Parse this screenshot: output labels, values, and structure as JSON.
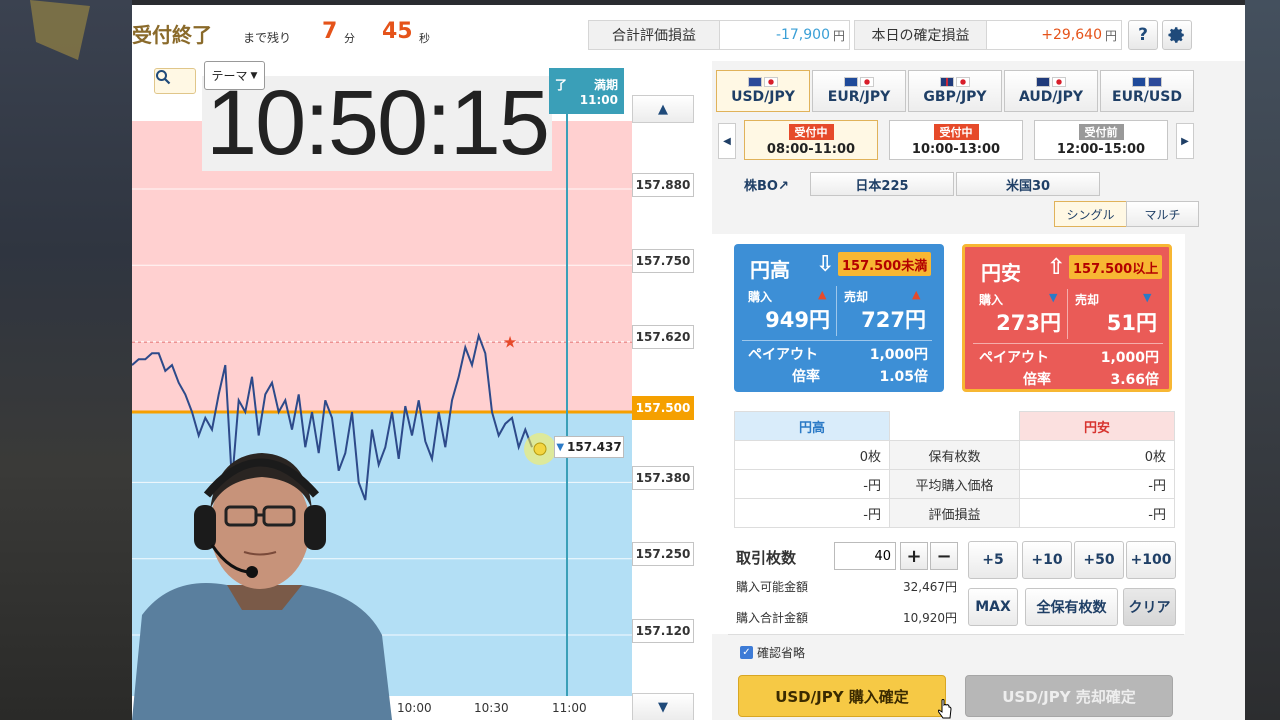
{
  "header": {
    "status": "受付終了",
    "remaining_label": "まで残り",
    "minutes": "7",
    "minutes_unit": "分",
    "seconds": "45",
    "seconds_unit": "秒",
    "total_pl_label": "合計評価損益",
    "total_pl_value": "-17,900",
    "today_pl_label": "本日の確定損益",
    "today_pl_value": "+29,640",
    "currency_unit": "円",
    "help_label": "?"
  },
  "chart": {
    "theme_label": "テーマ",
    "clock": "10:50:15",
    "expiry_label": "満期",
    "expiry_prefix": "了",
    "expiry_time": "11:00",
    "price_labels": [
      "157.880",
      "157.750",
      "157.620",
      "157.500",
      "157.380",
      "157.250",
      "157.120"
    ],
    "target_price": "157.500",
    "current_price": "157.437",
    "time_labels": [
      "10:00",
      "10:30",
      "11:00"
    ],
    "colors": {
      "high_zone": "#b3dff5",
      "low_zone": "#ffd0d0",
      "line": "#2d4a8a",
      "target": "#f5a000",
      "expiry": "#3a9fb8"
    }
  },
  "chart_data": {
    "type": "line",
    "title": "",
    "xlabel": "",
    "ylabel": "",
    "ylim": [
      157.07,
      157.98
    ],
    "x_ticks": [
      "10:00",
      "10:30",
      "11:00"
    ],
    "target": 157.5,
    "current": 157.437,
    "series": [
      {
        "name": "",
        "values": [
          157.58,
          157.59,
          157.59,
          157.6,
          157.6,
          157.57,
          157.58,
          157.55,
          157.53,
          157.5,
          157.46,
          157.49,
          157.47,
          157.53,
          157.58,
          157.38,
          157.52,
          157.5,
          157.56,
          157.46,
          157.53,
          157.55,
          157.5,
          157.52,
          157.47,
          157.53,
          157.44,
          157.5,
          157.43,
          157.52,
          157.49,
          157.4,
          157.43,
          157.5,
          157.38,
          157.35,
          157.47,
          157.41,
          157.44,
          157.5,
          157.42,
          157.51,
          157.46,
          157.52,
          157.45,
          157.42,
          157.5,
          157.44,
          157.52,
          157.56,
          157.61,
          157.58,
          157.63,
          157.6,
          157.5,
          157.46,
          157.48,
          157.49,
          157.44,
          157.47,
          157.44
        ]
      }
    ]
  },
  "panel": {
    "pairs": [
      {
        "label": "USD/JPY",
        "flags": [
          "#2c4a9a",
          "#ffffff"
        ]
      },
      {
        "label": "EUR/JPY",
        "flags": [
          "#1f4a9a",
          "#ffffff"
        ]
      },
      {
        "label": "GBP/JPY",
        "flags": [
          "#c9283a",
          "#ffffff"
        ]
      },
      {
        "label": "AUD/JPY",
        "flags": [
          "#1f3a7a",
          "#ffffff"
        ]
      },
      {
        "label": "EUR/USD",
        "flags": [
          "#1f4a9a",
          "#2c4a9a"
        ]
      }
    ],
    "sessions": [
      {
        "badge": "受付中",
        "time": "08:00-11:00",
        "badge_color": "#e64a2a"
      },
      {
        "badge": "受付中",
        "time": "10:00-13:00",
        "badge_color": "#e64a2a"
      },
      {
        "badge": "受付前",
        "time": "12:00-15:00",
        "badge_color": "#999999"
      }
    ],
    "stock_label": "株BO↗",
    "stocks": [
      "日本225",
      "米国30"
    ],
    "modes": [
      "シングル",
      "マルチ"
    ]
  },
  "cards": {
    "high": {
      "title": "円高",
      "condition": "157.500未満",
      "buy_label": "購入",
      "sell_label": "売却",
      "buy_price": "949円",
      "sell_price": "727円",
      "payout_label": "ペイアウト",
      "payout_value": "1,000円",
      "rate_label": "倍率",
      "rate_value": "1.05倍"
    },
    "low": {
      "title": "円安",
      "condition": "157.500以上",
      "buy_label": "購入",
      "sell_label": "売却",
      "buy_price": "273円",
      "sell_price": "51円",
      "payout_label": "ペイアウト",
      "payout_value": "1,000円",
      "rate_label": "倍率",
      "rate_value": "3.66倍"
    }
  },
  "holdings": {
    "high_header": "円高",
    "low_header": "円安",
    "rows": [
      {
        "label": "保有枚数",
        "high": "0枚",
        "low": "0枚"
      },
      {
        "label": "平均購入価格",
        "high": "-円",
        "low": "-円"
      },
      {
        "label": "評価損益",
        "high": "-円",
        "low": "-円"
      }
    ]
  },
  "order": {
    "qty_label": "取引枚数",
    "qty_value": "40",
    "plus": "+",
    "minus": "−",
    "available_label": "購入可能金額",
    "available_value": "32,467円",
    "total_label": "購入合計金額",
    "total_value": "10,920円",
    "quick": [
      "+5",
      "+10",
      "+50",
      "+100"
    ],
    "max_label": "MAX",
    "all_label": "全保有枚数",
    "clear_label": "クリア",
    "confirm_skip_label": "確認省略",
    "buy_confirm": "USD/JPY 購入確定",
    "sell_confirm": "USD/JPY 売却確定"
  }
}
